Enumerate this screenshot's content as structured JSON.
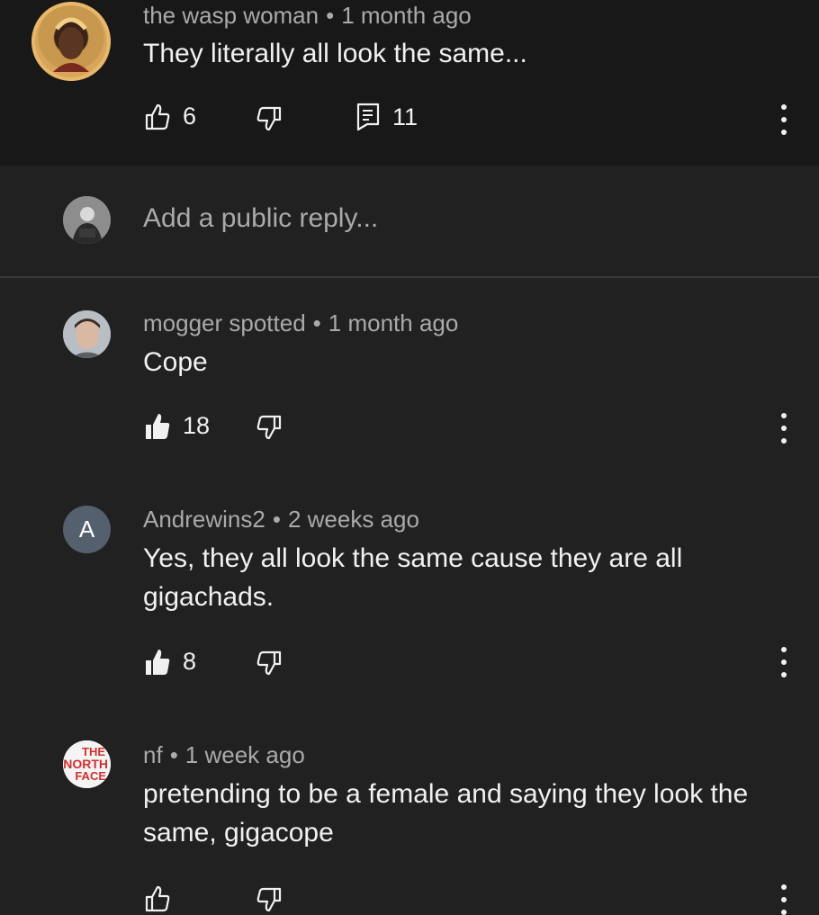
{
  "parent_comment": {
    "author": "the wasp woman",
    "time": "1 month ago",
    "text": "They literally all look the same...",
    "likes": "6",
    "replies": "11"
  },
  "reply_input": {
    "placeholder": "Add a public reply..."
  },
  "replies": [
    {
      "author": "mogger spotted",
      "time": "1 month ago",
      "text": "Cope",
      "likes": "18"
    },
    {
      "author": "Andrewins2",
      "avatar_letter": "A",
      "time": "2 weeks ago",
      "text": "Yes, they all look the same cause they are all gigachads.",
      "likes": "8"
    },
    {
      "author": "nf",
      "avatar_text": "THE NORTH FACE",
      "time": "1 week ago",
      "text": "pretending to be a female and saying they look the same, gigacope"
    }
  ],
  "colors": {
    "background": "#212121",
    "parent_background": "#181818",
    "secondary_text": "#aaaaaa",
    "avatar_A": "#54606e",
    "north_face_red": "#d32f2f"
  }
}
